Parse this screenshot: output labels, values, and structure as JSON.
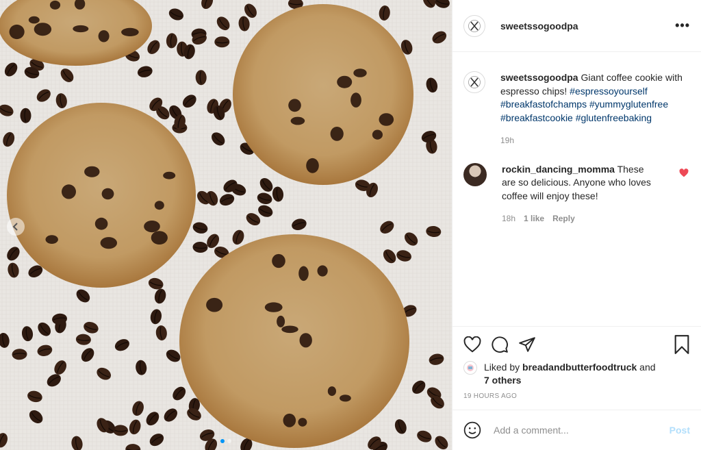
{
  "post": {
    "username": "sweetssogoodpa",
    "more_glyph": "•••"
  },
  "caption": {
    "username": "sweetssogoodpa",
    "text": " Giant coffee cookie with espresso chips! ",
    "hashtags": [
      "#espressoyourself",
      "#breakfastofchamps",
      "#yummyglutenfree",
      "#breakfastcookie",
      "#glutenfreebaking"
    ],
    "time": "19h"
  },
  "comment": {
    "username": "rockin_dancing_momma",
    "text": " These are so delicious. Anyone who loves coffee will enjoy these!",
    "time": "18h",
    "likes": "1 like",
    "reply": "Reply",
    "liked": true
  },
  "likes": {
    "prefix": "Liked by ",
    "user": "breadandbutterfoodtruck",
    "and": " and",
    "others": "7 others"
  },
  "timestamp": "19 HOURS AGO",
  "composer": {
    "placeholder": "Add a comment...",
    "post_label": "Post"
  },
  "carousel": {
    "count": 2,
    "active": 0
  },
  "colors": {
    "accent": "#0095f6",
    "heart": "#ed4956",
    "hashtag": "#00376b",
    "muted": "#8e8e8e",
    "post_disabled": "#b2dffc"
  },
  "icons": [
    "heart-icon",
    "comment-icon",
    "share-icon",
    "bookmark-icon",
    "emoji-icon",
    "chevron-left-icon",
    "more-icon"
  ]
}
